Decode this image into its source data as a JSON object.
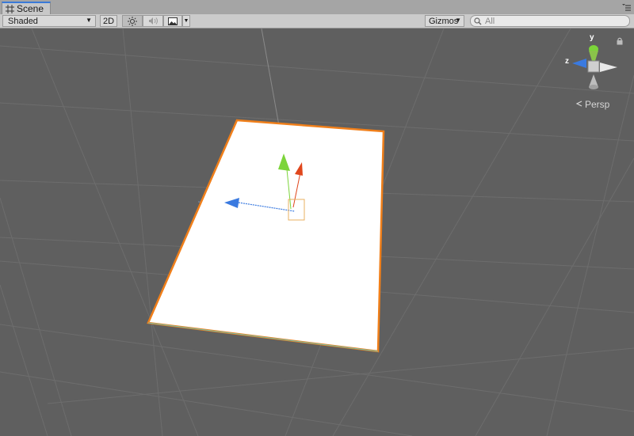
{
  "tab": {
    "title": "Scene",
    "icon": "grid-icon"
  },
  "toolbar": {
    "shading_mode": "Shaded",
    "mode_2d_label": "2D",
    "lighting_icon": "sun-icon",
    "audio_icon": "speaker-icon",
    "effects_icon": "image-icon",
    "gizmos_label": "Gizmos",
    "search_placeholder": "All"
  },
  "orientation_gizmo": {
    "y_label": "y",
    "z_label": "z",
    "projection_label": "Persp"
  },
  "colors": {
    "background": "#5f5f5f",
    "selection_outline": "#f07f1a",
    "x_axis": "#e0461c",
    "y_axis": "#7cd43a",
    "z_axis": "#3a7ae0",
    "plane": "#ffffff"
  }
}
